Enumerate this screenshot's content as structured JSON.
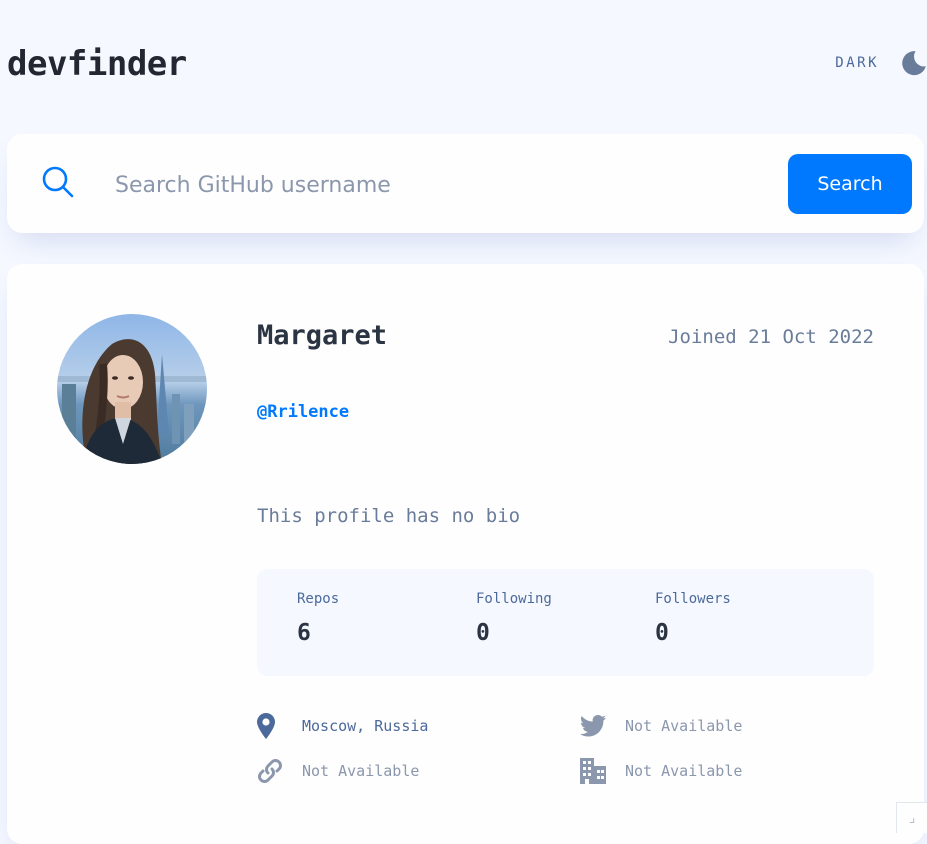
{
  "header": {
    "logo": "devfinder",
    "theme_label": "DARK",
    "theme_icon": "moon-icon"
  },
  "search": {
    "placeholder": "Search GitHub username",
    "value": "",
    "button_label": "Search",
    "icon": "search-icon"
  },
  "profile": {
    "name": "Margaret",
    "joined": "Joined 21 Oct 2022",
    "username": "@Rrilence",
    "bio": "This profile has no bio",
    "avatar_alt": "avatar"
  },
  "stats": [
    {
      "label": "Repos",
      "value": "6"
    },
    {
      "label": "Following",
      "value": "0"
    },
    {
      "label": "Followers",
      "value": "0"
    }
  ],
  "links": {
    "location": {
      "icon": "location-pin-icon",
      "text": "Moscow, Russia"
    },
    "twitter": {
      "icon": "twitter-icon",
      "text": "Not Available"
    },
    "website": {
      "icon": "link-icon",
      "text": "Not Available"
    },
    "company": {
      "icon": "building-icon",
      "text": "Not Available"
    }
  },
  "colors": {
    "accent": "#0079ff",
    "background": "#f5f8ff",
    "card": "#fefefe",
    "text_dark": "#2b3442",
    "text_muted": "#697c9a",
    "icon": "#4b6a9b"
  }
}
